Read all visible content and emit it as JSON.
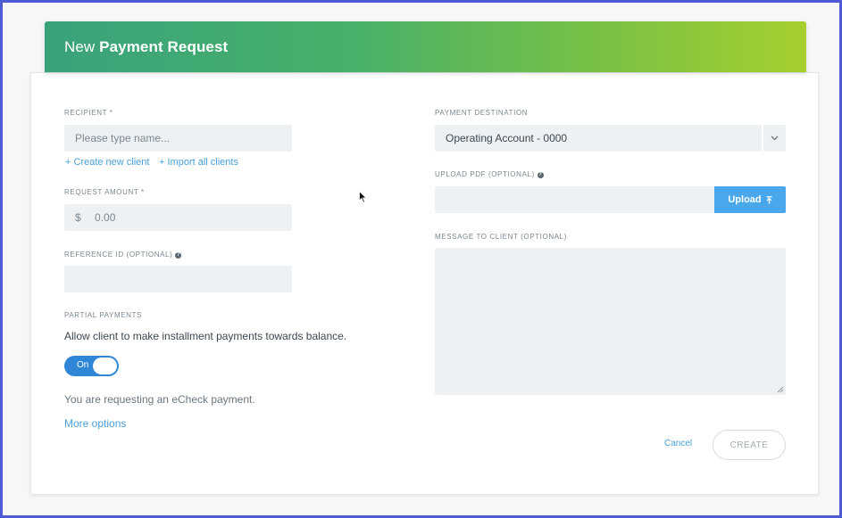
{
  "header": {
    "title_prefix": "New",
    "title_bold": "Payment Request"
  },
  "recipient": {
    "label": "RECIPIENT *",
    "placeholder": "Please type name...",
    "create_link": "+ Create new client",
    "import_link": "+ Import all clients"
  },
  "amount": {
    "label": "REQUEST AMOUNT *",
    "currency": "$",
    "value": "0.00"
  },
  "reference": {
    "label": "REFERENCE ID (OPTIONAL)",
    "value": ""
  },
  "partial": {
    "label": "PARTIAL PAYMENTS",
    "description": "Allow client to make installment payments towards balance.",
    "toggle_label": "On",
    "toggle_state": true
  },
  "echeck_note": "You are requesting an eCheck payment.",
  "more_options": "More options",
  "destination": {
    "label": "PAYMENT DESTINATION",
    "value": "Operating Account - 0000"
  },
  "upload": {
    "label": "UPLOAD PDF (OPTIONAL)",
    "button": "Upload",
    "value": ""
  },
  "message": {
    "label": "MESSAGE TO CLIENT (OPTIONAL)",
    "value": ""
  },
  "actions": {
    "cancel": "Cancel",
    "create": "CREATE"
  },
  "colors": {
    "accent": "#2f86d6",
    "link": "#4a9fd9",
    "upload_button": "#49a8ec",
    "header_gradient_start": "#3aa27b",
    "header_gradient_end": "#a6cf2f"
  },
  "icons": {
    "select_arrow": "chevron-down-icon",
    "upload": "upload-arrow-icon",
    "help": "question-circle-icon",
    "cursor": "mouse-cursor-icon"
  }
}
